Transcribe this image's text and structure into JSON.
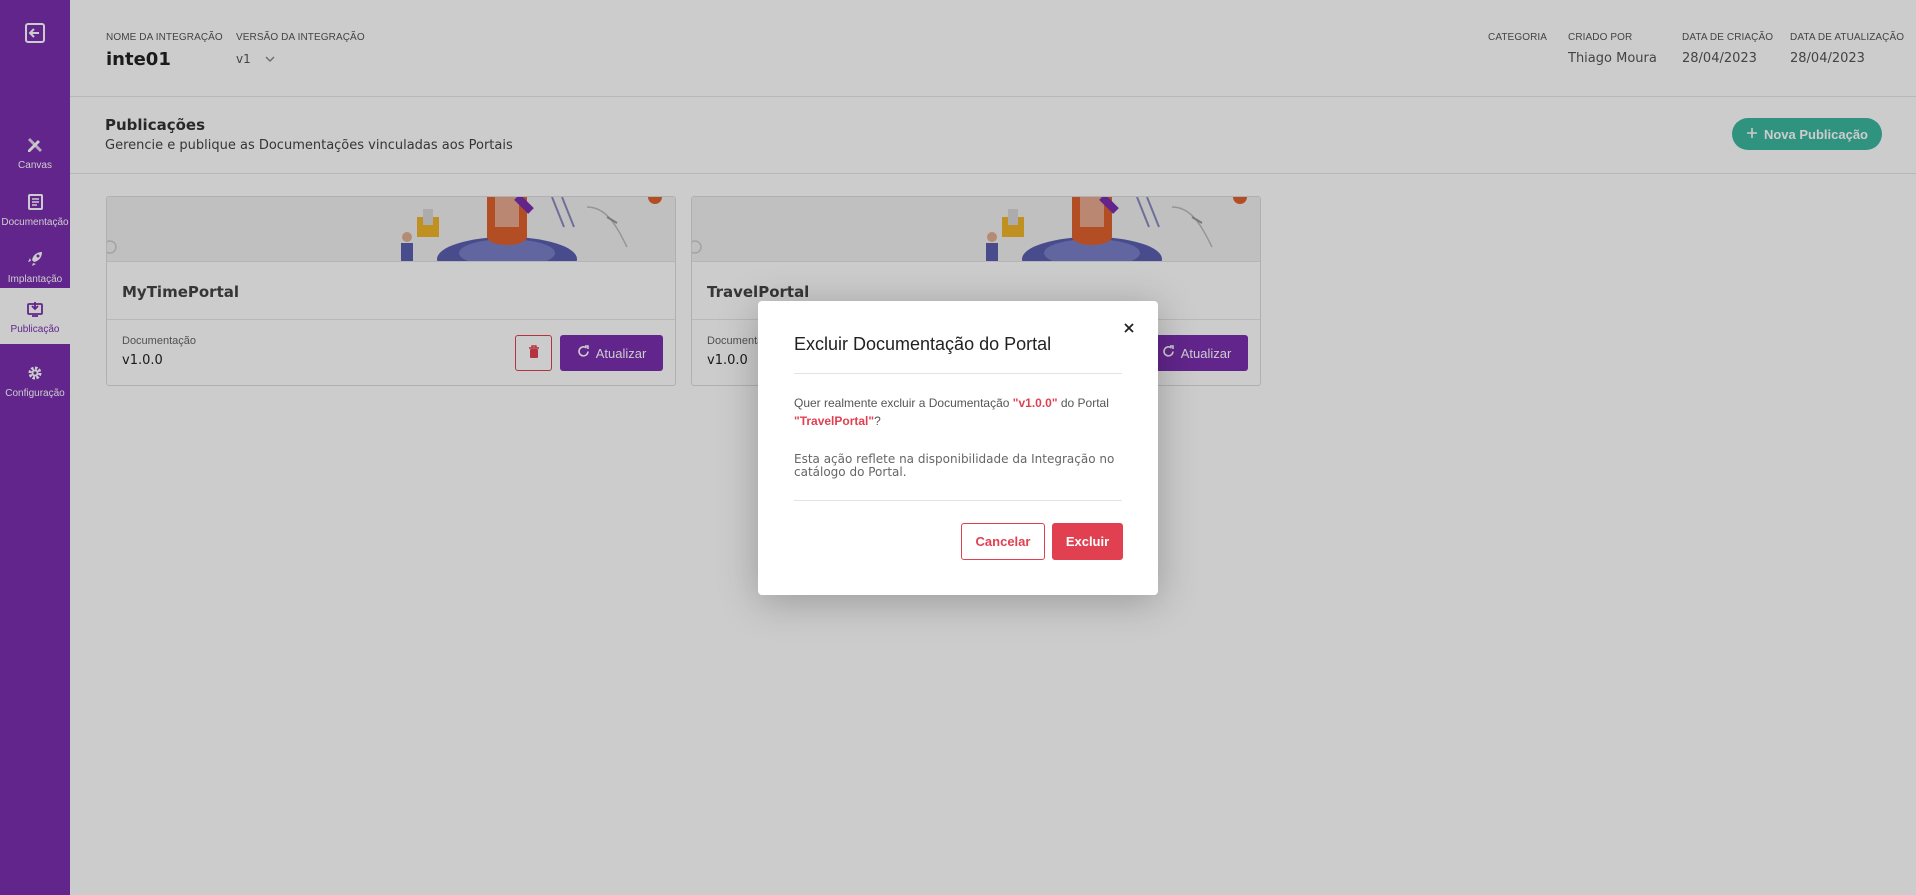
{
  "colors": {
    "sidebar": "#7b2fb0",
    "accent_teal": "#3bb8a0",
    "danger": "#e04050"
  },
  "sidebar": {
    "back_icon": "exit-icon",
    "items": [
      {
        "label": "Canvas",
        "icon": "pencil-ruler-icon"
      },
      {
        "label": "Documentação",
        "icon": "book-icon"
      },
      {
        "label": "Implantação",
        "icon": "rocket-icon"
      },
      {
        "label": "Publicação",
        "icon": "publish-icon"
      },
      {
        "label": "Configuração",
        "icon": "gear-icon"
      }
    ]
  },
  "header": {
    "integration_name_label": "NOME DA INTEGRAÇÃO",
    "integration_name": "inte01",
    "version_label": "VERSÃO DA INTEGRAÇÃO",
    "version": "v1",
    "category_label": "CATEGORIA",
    "category": "",
    "created_by_label": "CRIADO POR",
    "created_by": "Thiago Moura",
    "created_at_label": "DATA DE CRIAÇÃO",
    "created_at": "28/04/2023",
    "updated_at_label": "DATA DE ATUALIZAÇÃO",
    "updated_at": "28/04/2023"
  },
  "section": {
    "title": "Publicações",
    "subtitle": "Gerencie e publique as Documentações vinculadas aos Portais",
    "new_button": "Nova Publicação"
  },
  "cards": [
    {
      "name": "MyTimePortal",
      "doc_label": "Documentação",
      "doc_version": "v1.0.0",
      "update_label": "Atualizar"
    },
    {
      "name": "TravelPortal",
      "doc_label": "Documentação",
      "doc_version": "v1.0.0",
      "update_label": "Atualizar"
    }
  ],
  "modal": {
    "title": "Excluir Documentação do Portal",
    "question_prefix": "Quer realmente excluir a Documentação ",
    "doc_version": "\"v1.0.0\"",
    "question_mid": " do Portal ",
    "portal_name": "\"TravelPortal\"",
    "question_suffix": "?",
    "note": "Esta ação reflete na disponibilidade da Integração no catálogo do Portal.",
    "cancel_label": "Cancelar",
    "delete_label": "Excluir"
  }
}
